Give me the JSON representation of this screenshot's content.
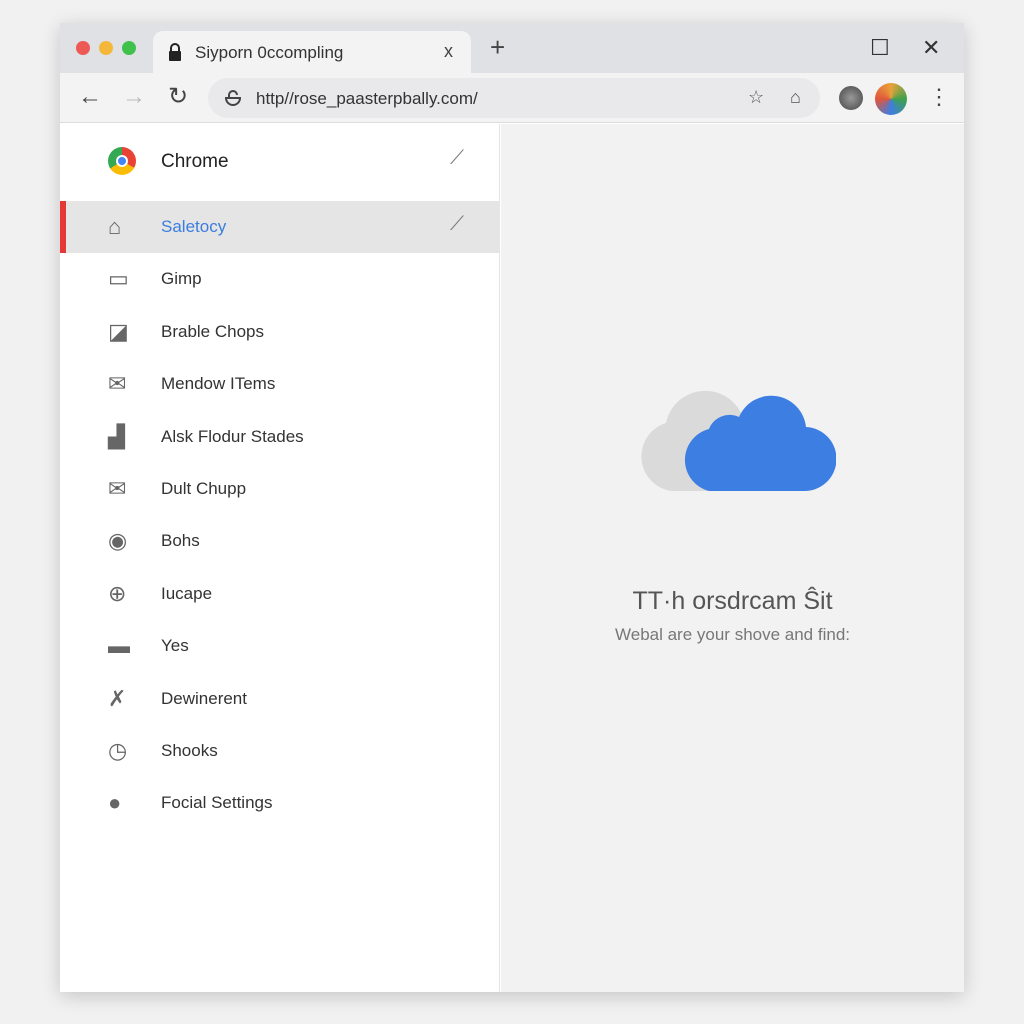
{
  "window": {
    "traffic_lights": [
      "#ed5a55",
      "#f5b73a",
      "#3fc14b"
    ]
  },
  "tab": {
    "title": "Siyporn 0ccompling",
    "close": "x",
    "new_tab": "+"
  },
  "window_controls": {
    "maximize": "☐",
    "close": "✕"
  },
  "toolbar": {
    "back": "←",
    "forward": "→",
    "reload": "↻",
    "url": "http//rose_paasterpbally.com/",
    "menu": "⋮"
  },
  "sidebar": {
    "header": {
      "label": "Chrome",
      "icon": "chrome-logo-icon"
    },
    "items": [
      {
        "label": "Saletocy",
        "icon": "home-icon",
        "active": true
      },
      {
        "label": "Gimp",
        "icon": "tablet-icon"
      },
      {
        "label": "Brable Chops",
        "icon": "puzzle-icon"
      },
      {
        "label": "Mendow ITems",
        "icon": "mail-icon"
      },
      {
        "label": "Alsk Flodur Stades",
        "icon": "chart-icon"
      },
      {
        "label": "Dult Chupp",
        "icon": "envelope-icon"
      },
      {
        "label": "Bohs",
        "icon": "circle-icon"
      },
      {
        "label": "Iucape",
        "icon": "plus-circle-icon"
      },
      {
        "label": "Yes",
        "icon": "box-icon"
      },
      {
        "label": "Dewinerent",
        "icon": "tools-icon"
      },
      {
        "label": "Shooks",
        "icon": "clock-icon"
      },
      {
        "label": "Focial Settings",
        "icon": "cloud-settings-icon"
      }
    ],
    "accent": "#e53935"
  },
  "main": {
    "title": "TT·h orsdrcam Ŝit",
    "subtitle": "Webal are your shove and find:",
    "cloud_color": "#3d7ee3"
  }
}
